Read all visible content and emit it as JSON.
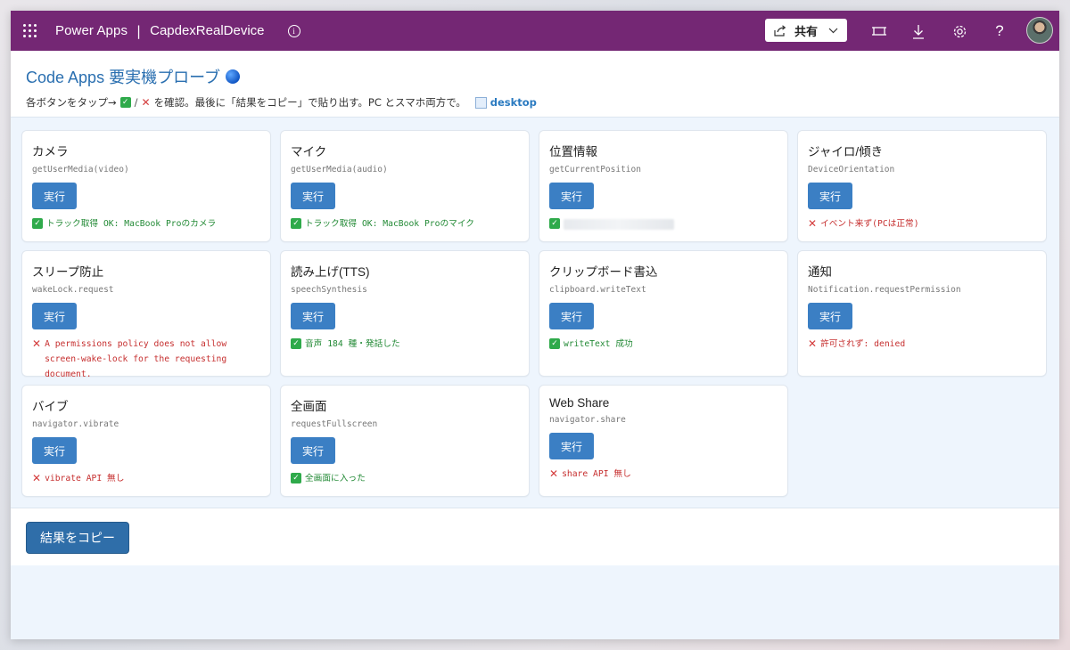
{
  "topbar": {
    "brand": "Power Apps",
    "separator": "|",
    "app_name": "CapdexRealDevice",
    "share_label": "共有",
    "accent": "#742774"
  },
  "header": {
    "title": "Code Apps 要実機プローブ",
    "subtitle_pre": "各ボタンをタップ→",
    "subtitle_post": "を確認。最後に「結果をコピー」で貼り出す。PC とスマホ両方で。",
    "device": "desktop"
  },
  "cards": [
    {
      "title": "カメラ",
      "api": "getUserMedia(video)",
      "button": "実行",
      "status": "ok",
      "result": "トラック取得 OK: MacBook Proのカメラ"
    },
    {
      "title": "マイク",
      "api": "getUserMedia(audio)",
      "button": "実行",
      "status": "ok",
      "result": "トラック取得 OK: MacBook Proのマイク"
    },
    {
      "title": "位置情報",
      "api": "getCurrentPosition",
      "button": "実行",
      "status": "ok",
      "result": ""
    },
    {
      "title": "ジャイロ/傾き",
      "api": "DeviceOrientation",
      "button": "実行",
      "status": "ng",
      "result": "イベント来ず(PCは正常)"
    },
    {
      "title": "スリープ防止",
      "api": "wakeLock.request",
      "button": "実行",
      "status": "ng",
      "result": "A permissions policy does not allow screen-wake-lock for the requesting document."
    },
    {
      "title": "読み上げ(TTS)",
      "api": "speechSynthesis",
      "button": "実行",
      "status": "ok",
      "result": "音声 184 種・発話した"
    },
    {
      "title": "クリップボード書込",
      "api": "clipboard.writeText",
      "button": "実行",
      "status": "ok",
      "result": "writeText 成功"
    },
    {
      "title": "通知",
      "api": "Notification.requestPermission",
      "button": "実行",
      "status": "ng",
      "result": "許可されず: denied"
    },
    {
      "title": "バイブ",
      "api": "navigator.vibrate",
      "button": "実行",
      "status": "ng",
      "result": "vibrate API 無し"
    },
    {
      "title": "全画面",
      "api": "requestFullscreen",
      "button": "実行",
      "status": "ok",
      "result": "全画面に入った"
    },
    {
      "title": "Web Share",
      "api": "navigator.share",
      "button": "実行",
      "status": "ng",
      "result": "share API 無し"
    }
  ],
  "footer": {
    "copy_label": "結果をコピー"
  }
}
